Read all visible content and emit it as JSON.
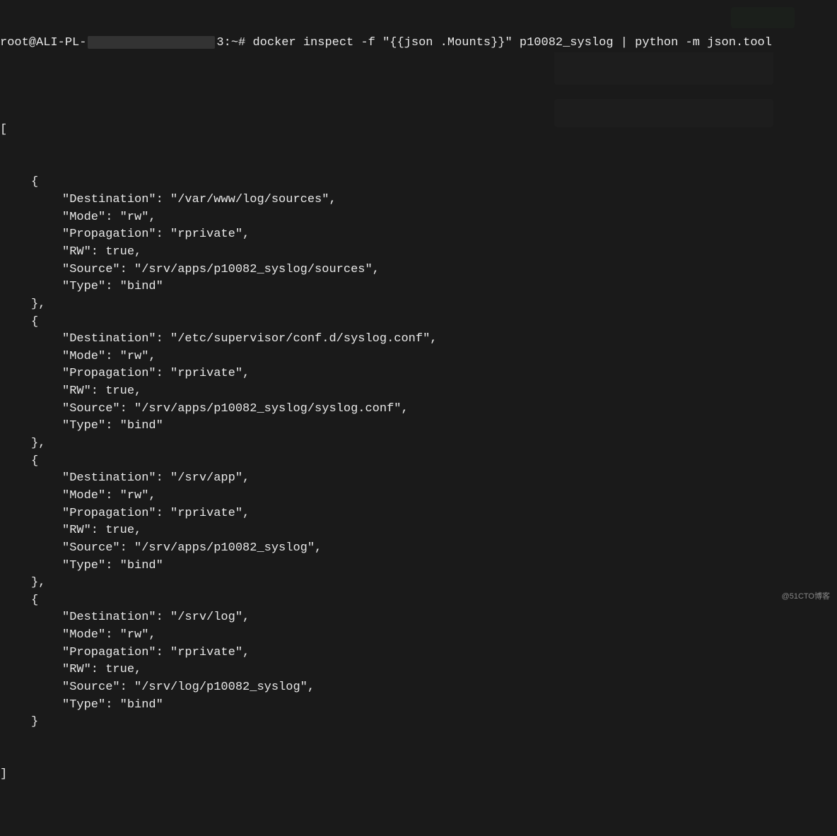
{
  "prompt": {
    "user": "root@ALI-PL-",
    "host_suffix": "3:~# ",
    "command": "docker inspect -f \"{{json .Mounts}}\" p10082_syslog | python -m json.tool"
  },
  "output": {
    "open_bracket": "[",
    "close_bracket": "]",
    "mounts": [
      {
        "Destination": "/var/www/log/sources",
        "Mode": "rw",
        "Propagation": "rprivate",
        "RW": "true",
        "Source": "/srv/apps/p10082_syslog/sources",
        "Type": "bind"
      },
      {
        "Destination": "/etc/supervisor/conf.d/syslog.conf",
        "Mode": "rw",
        "Propagation": "rprivate",
        "RW": "true",
        "Source": "/srv/apps/p10082_syslog/syslog.conf",
        "Type": "bind"
      },
      {
        "Destination": "/srv/app",
        "Mode": "rw",
        "Propagation": "rprivate",
        "RW": "true",
        "Source": "/srv/apps/p10082_syslog",
        "Type": "bind"
      },
      {
        "Destination": "/srv/log",
        "Mode": "rw",
        "Propagation": "rprivate",
        "RW": "true",
        "Source": "/srv/log/p10082_syslog",
        "Type": "bind"
      }
    ]
  },
  "watermark": "@51CTO博客"
}
